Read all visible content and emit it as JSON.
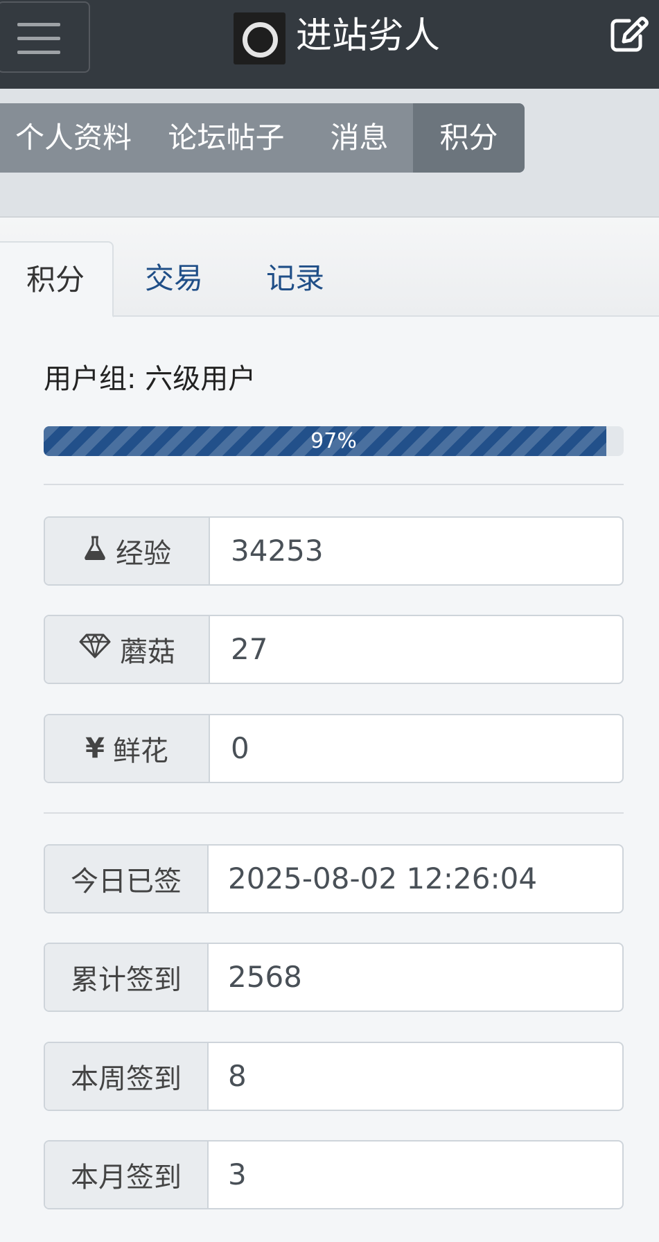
{
  "header": {
    "brand_title": "进站劣人",
    "menu_icon": "hamburger-menu-icon",
    "logo_icon": "circle-logo-icon",
    "edit_icon": "edit-square-icon"
  },
  "subnav": {
    "items": [
      {
        "label": "个人资料",
        "active": false
      },
      {
        "label": "论坛帖子",
        "active": false
      },
      {
        "label": "消息",
        "active": false
      },
      {
        "label": "积分",
        "active": true
      }
    ]
  },
  "tabs": [
    {
      "label": "积分",
      "active": true
    },
    {
      "label": "交易",
      "active": false
    },
    {
      "label": "记录",
      "active": false
    }
  ],
  "user_group": {
    "label": "用户组: 六级用户"
  },
  "progress": {
    "value": 97,
    "text": "97%"
  },
  "points": [
    {
      "icon": "flask-icon",
      "label": "经验",
      "value": "34253"
    },
    {
      "icon": "diamond-icon",
      "label": "蘑菇",
      "value": "27"
    },
    {
      "icon": "yen-icon",
      "label": "鲜花",
      "value": "0"
    }
  ],
  "checkin": [
    {
      "label": "今日已签",
      "value": "2025-08-02 12:26:04"
    },
    {
      "label": "累计签到",
      "value": "2568"
    },
    {
      "label": "本周签到",
      "value": "8"
    },
    {
      "label": "本月签到",
      "value": "3"
    }
  ],
  "colors": {
    "navbar": "#343a40",
    "pill_bg": "#868e96",
    "pill_active": "#6c757d",
    "link": "#1f4e87",
    "progress": "#22508a"
  }
}
